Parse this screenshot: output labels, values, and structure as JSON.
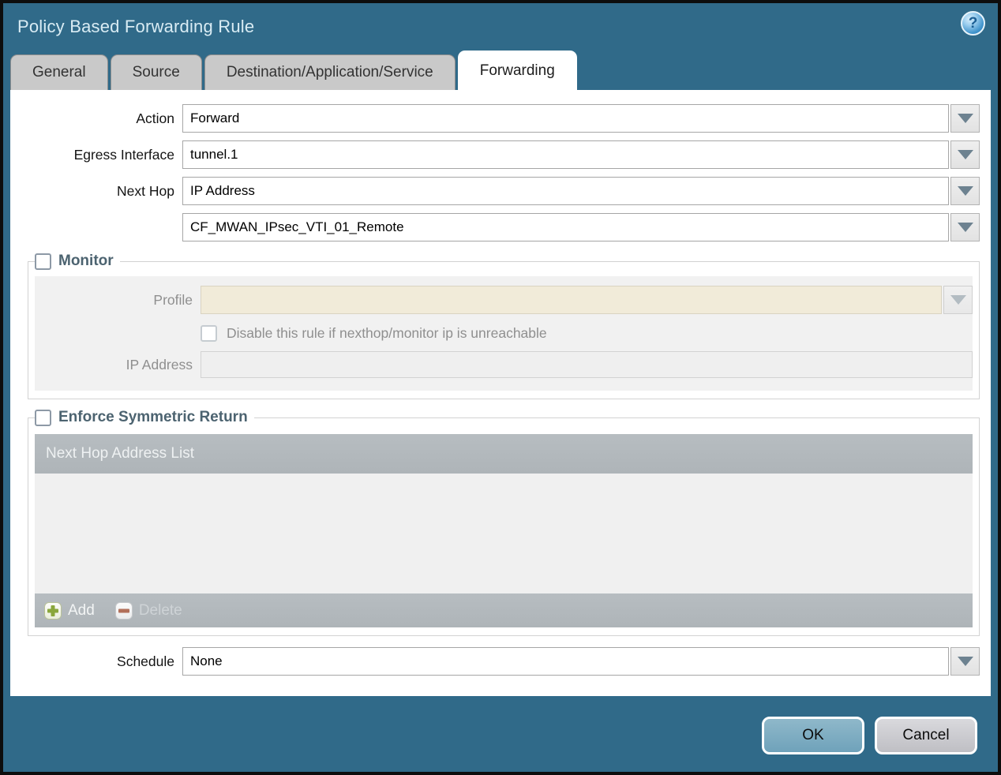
{
  "dialog": {
    "title": "Policy Based Forwarding Rule",
    "help_glyph": "?"
  },
  "tabs": [
    {
      "label": "General",
      "active": false
    },
    {
      "label": "Source",
      "active": false
    },
    {
      "label": "Destination/Application/Service",
      "active": false
    },
    {
      "label": "Forwarding",
      "active": true
    }
  ],
  "form": {
    "action": {
      "label": "Action",
      "value": "Forward"
    },
    "egress_interface": {
      "label": "Egress Interface",
      "value": "tunnel.1"
    },
    "next_hop": {
      "label": "Next Hop",
      "value": "IP Address"
    },
    "next_hop_address": {
      "value": "CF_MWAN_IPsec_VTI_01_Remote"
    },
    "schedule": {
      "label": "Schedule",
      "value": "None"
    }
  },
  "monitor": {
    "legend": "Monitor",
    "checked": false,
    "profile_label": "Profile",
    "profile_value": "",
    "disable_rule_label": "Disable this rule if nexthop/monitor ip is unreachable",
    "disable_rule_checked": false,
    "ip_address_label": "IP Address",
    "ip_address_value": ""
  },
  "symmetric_return": {
    "legend": "Enforce Symmetric Return",
    "checked": false,
    "table_header": "Next Hop Address List",
    "rows": [],
    "add_label": "Add",
    "delete_label": "Delete"
  },
  "footer": {
    "ok_label": "OK",
    "cancel_label": "Cancel"
  },
  "icons": {
    "help": "question-icon",
    "dropdown": "chevron-down-icon",
    "add": "plus-icon",
    "delete": "minus-icon"
  },
  "colors": {
    "titlebar_teal": "#306a89",
    "active_tab_bg": "#ffffff",
    "inactive_tab_bg": "#c9c9c9",
    "disabled_field_beige": "#f1ebd9",
    "section_bg": "#f1f1f1",
    "table_bar_gray": "#b2b8bc",
    "legend_slate": "#4c6370",
    "add_green": "#8aa73c",
    "delete_red": "#b2705a",
    "ok_button_blue": "#7fadc2",
    "cancel_button_gray": "#cacace"
  }
}
